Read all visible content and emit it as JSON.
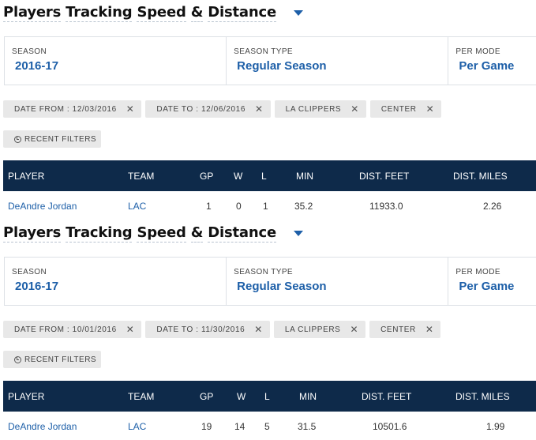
{
  "tables": [
    {
      "title_words": [
        "Players",
        "Tracking",
        "Speed",
        "&",
        "Distance"
      ],
      "season": {
        "label": "SEASON",
        "value": "2016-17"
      },
      "season_type": {
        "label": "SEASON TYPE",
        "value": "Regular Season"
      },
      "per_mode": {
        "label": "PER MODE",
        "value": "Per Game"
      },
      "filters": [
        "DATE FROM : 12/03/2016",
        "DATE TO : 12/06/2016",
        "LA CLIPPERS",
        "CENTER"
      ],
      "recent_filters_label": "RECENT FILTERS",
      "columns": [
        "PLAYER",
        "TEAM",
        "GP",
        "W",
        "L",
        "MIN",
        "DIST. FEET",
        "DIST. MILES"
      ],
      "row": [
        "DeAndre Jordan",
        "LAC",
        "1",
        "0",
        "1",
        "35.2",
        "11933.0",
        "2.26"
      ]
    },
    {
      "title_words": [
        "Players",
        "Tracking",
        "Speed",
        "&",
        "Distance"
      ],
      "season": {
        "label": "SEASON",
        "value": "2016-17"
      },
      "season_type": {
        "label": "SEASON TYPE",
        "value": "Regular Season"
      },
      "per_mode": {
        "label": "PER MODE",
        "value": "Per Game"
      },
      "filters": [
        "DATE FROM : 10/01/2016",
        "DATE TO : 11/30/2016",
        "LA CLIPPERS",
        "CENTER"
      ],
      "recent_filters_label": "RECENT FILTERS",
      "columns": [
        "PLAYER",
        "TEAM",
        "GP",
        "W",
        "L",
        "MIN",
        "DIST. FEET",
        "DIST. MILES"
      ],
      "row": [
        "DeAndre Jordan",
        "LAC",
        "19",
        "14",
        "5",
        "31.5",
        "10501.6",
        "1.99"
      ]
    }
  ],
  "colors": {
    "accent": "#1d5fa8",
    "header_bg": "#0e2a4a",
    "chip_bg": "#e8e8e8"
  },
  "icons": {
    "dropdown": "caret-down-icon",
    "remove": "close-icon",
    "history": "clock-icon"
  }
}
